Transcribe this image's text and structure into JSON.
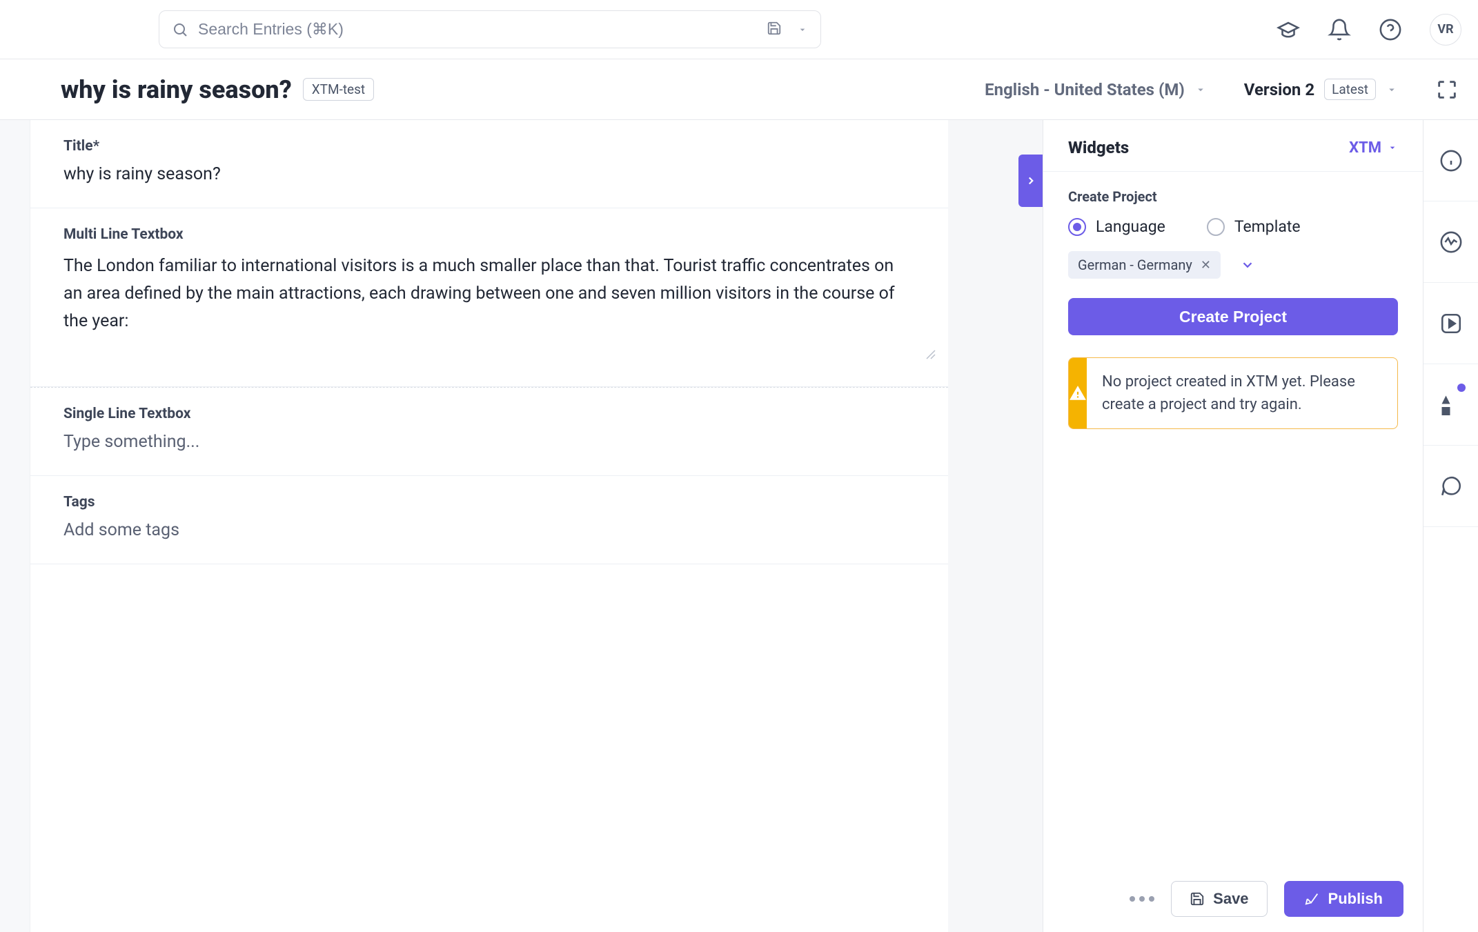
{
  "search": {
    "placeholder": "Search Entries (⌘K)"
  },
  "user": {
    "initials": "VR"
  },
  "header": {
    "title": "why is rainy season?",
    "badge": "XTM-test",
    "locale": "English - United States (M)",
    "version_label": "Version 2",
    "version_badge": "Latest"
  },
  "fields": {
    "title_label": "Title*",
    "title_value": "why is rainy season?",
    "multiline_label": "Multi Line Textbox",
    "multiline_value": "The London familiar to international visitors is a much smaller place than that. Tourist traffic concentrates on an area defined by the main attractions, each drawing between one and seven million visitors in the course of the year:",
    "single_label": "Single Line Textbox",
    "single_placeholder": "Type something...",
    "tags_label": "Tags",
    "tags_placeholder": "Add some tags"
  },
  "widgets": {
    "title": "Widgets",
    "dropdown": "XTM",
    "create_section": "Create Project",
    "radio_language": "Language",
    "radio_template": "Template",
    "chip_value": "German - Germany",
    "create_button": "Create Project",
    "warning": "No project created in XTM yet. Please create a project and try again."
  },
  "footer": {
    "save": "Save",
    "publish": "Publish"
  }
}
